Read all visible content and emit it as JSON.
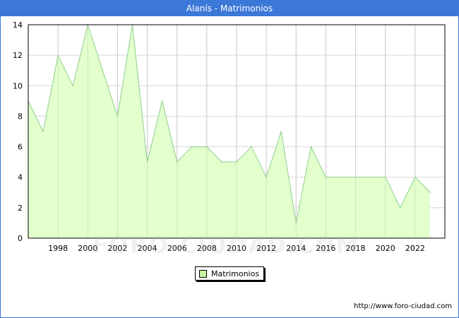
{
  "title": "Alanís - Matrimonios",
  "source": "http://www.foro-ciudad.com",
  "watermark": "FORO-CIUDAD.COM",
  "colors": {
    "header": "#3c78d8",
    "fill": "#e2ffcc",
    "line": "#8fcf8f",
    "grid": "#d8d8d8",
    "swatch": "#c8f5a0"
  },
  "chart_data": {
    "type": "area",
    "title": "Alanís - Matrimonios",
    "x": [
      1996,
      1997,
      1998,
      1999,
      2000,
      2001,
      2002,
      2003,
      2004,
      2005,
      2006,
      2007,
      2008,
      2009,
      2010,
      2011,
      2012,
      2013,
      2014,
      2015,
      2016,
      2017,
      2018,
      2019,
      2020,
      2021,
      2022,
      2023
    ],
    "series": [
      {
        "name": "Matrimonios",
        "values": [
          9,
          7,
          12,
          10,
          14,
          11,
          8,
          14,
          5,
          9,
          5,
          6,
          6,
          5,
          5,
          6,
          4,
          7,
          1,
          6,
          4,
          4,
          4,
          4,
          4,
          2,
          4,
          3
        ]
      }
    ],
    "xticks": [
      "1998",
      "2000",
      "2002",
      "2004",
      "2006",
      "2008",
      "2010",
      "2012",
      "2014",
      "2016",
      "2018",
      "2020",
      "2022"
    ],
    "yticks": [
      "0",
      "2",
      "4",
      "6",
      "8",
      "10",
      "12",
      "14"
    ],
    "xlim": [
      1996,
      2024
    ],
    "ylim": [
      0,
      14
    ],
    "grid": true,
    "legend": "bottom-center"
  }
}
